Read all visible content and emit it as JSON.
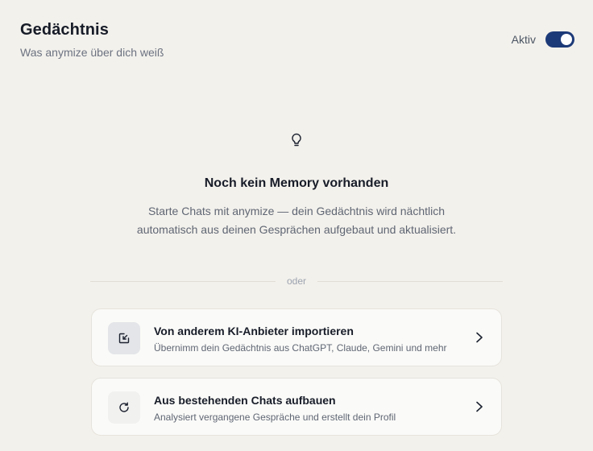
{
  "header": {
    "title": "Gedächtnis",
    "subtitle": "Was anymize über dich weiß"
  },
  "toggle": {
    "label": "Aktiv",
    "state": "on",
    "color": "#1d3a78"
  },
  "empty_state": {
    "icon": "lightbulb-icon",
    "title": "Noch kein Memory vorhanden",
    "text": "Starte Chats mit anymize — dein Gedächtnis wird nächtlich automatisch aus deinen Gesprächen aufgebaut und aktualisiert."
  },
  "divider": {
    "label": "oder"
  },
  "options": [
    {
      "icon": "import-icon",
      "title": "Von anderem KI-Anbieter importieren",
      "subtitle": "Übernimm dein Gedächtnis aus ChatGPT, Claude, Gemini und mehr"
    },
    {
      "icon": "refresh-icon",
      "title": "Aus bestehenden Chats aufbauen",
      "subtitle": "Analysiert vergangene Gespräche und erstellt dein Profil"
    }
  ]
}
